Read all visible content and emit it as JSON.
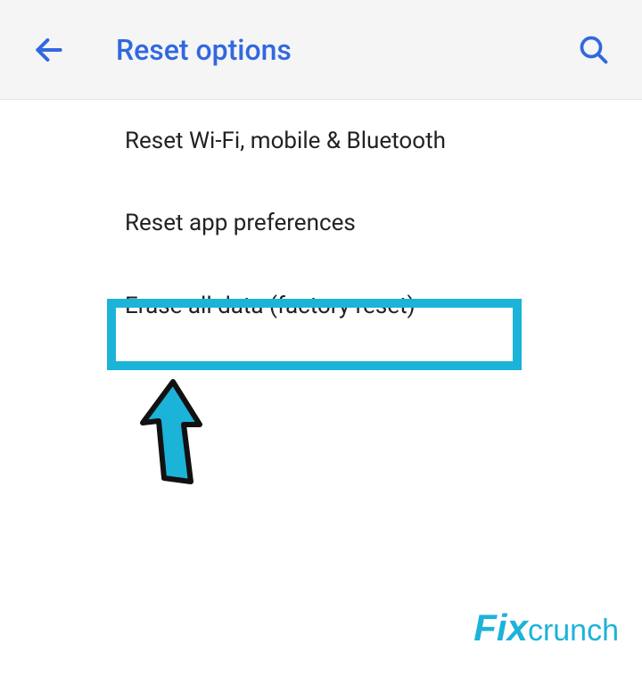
{
  "header": {
    "title": "Reset options"
  },
  "options": {
    "item0": "Reset Wi-Fi, mobile & Bluetooth",
    "item1": "Reset app preferences",
    "item2": "Erase all data (factory reset)"
  },
  "watermark": {
    "accent": "Fix",
    "rest": "crunch"
  },
  "colors": {
    "accent_blue": "#3168e0",
    "highlight": "#1cb3d9"
  }
}
